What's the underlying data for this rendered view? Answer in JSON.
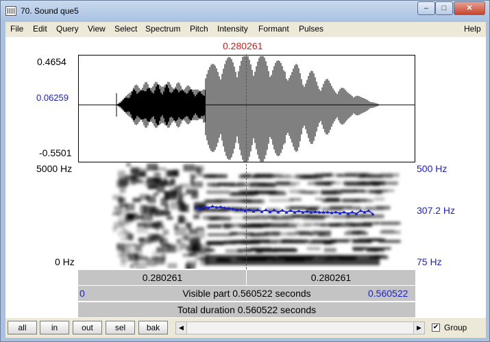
{
  "window": {
    "title": "70. Sound que5",
    "min_glyph": "–",
    "max_glyph": "□",
    "close_glyph": "✕"
  },
  "menu": [
    "File",
    "Edit",
    "Query",
    "View",
    "Select",
    "Spectrum",
    "Pitch",
    "Intensity",
    "Formant",
    "Pulses",
    "Help"
  ],
  "waveform": {
    "max_label": "0.4654",
    "mid_label": "0.06259",
    "min_label": "-0.5501"
  },
  "spectrogram": {
    "top_freq_label": "5000 Hz",
    "bottom_freq_label": "0 Hz",
    "pitch_top_label": "500 Hz",
    "pitch_value_label": "307.2 Hz",
    "pitch_bottom_label": "75 Hz"
  },
  "cursor": {
    "time_label": "0.280261"
  },
  "time_bars": {
    "left_half": "0.280261",
    "right_half": "0.280261",
    "visible_start": "0",
    "visible_text": "Visible part 0.560522 seconds",
    "visible_end": "0.560522",
    "total_text": "Total duration 0.560522 seconds"
  },
  "buttons": {
    "all": "all",
    "in": "in",
    "out": "out",
    "sel": "sel",
    "bak": "bak"
  },
  "scroll": {
    "left_glyph": "◀",
    "right_glyph": "▶"
  },
  "group": {
    "label": "Group",
    "checked": true,
    "check_glyph": "✔"
  },
  "colors": {
    "cursor": "#d81c14",
    "pitch": "#1c21c4",
    "label_blue": "#1c21c4"
  }
}
